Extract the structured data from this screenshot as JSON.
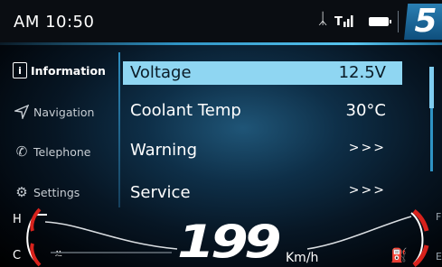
{
  "status_bar": {
    "time": "AM 10:50",
    "gear": "5",
    "icons": [
      "bluetooth-icon",
      "signal-icon",
      "battery-icon"
    ]
  },
  "sidebar": {
    "items": [
      {
        "label": "Information",
        "icon": "info-icon",
        "active": true
      },
      {
        "label": "Navigation",
        "icon": "navigation-arrow-icon",
        "active": false
      },
      {
        "label": "Telephone",
        "icon": "phone-icon",
        "active": false
      },
      {
        "label": "Settings",
        "icon": "gear-icon",
        "active": false
      }
    ]
  },
  "main": {
    "rows": [
      {
        "label": "Voltage",
        "value": "12.5V",
        "selected": true
      },
      {
        "label": "Coolant Temp",
        "value": "30°C",
        "selected": false
      },
      {
        "label": "Warning",
        "value": ">>>",
        "selected": false
      },
      {
        "label": "Service",
        "value": ">>>",
        "selected": false
      }
    ]
  },
  "gauges": {
    "speed": "199",
    "speed_unit": "Km/h",
    "temp_high_label": "H",
    "temp_low_label": "C",
    "fuel_full_label": "F",
    "fuel_empty_label": "E"
  },
  "colors": {
    "accent": "#2f93c4",
    "selected_row": "#8fd6f2",
    "warning_red": "#d8221c"
  }
}
